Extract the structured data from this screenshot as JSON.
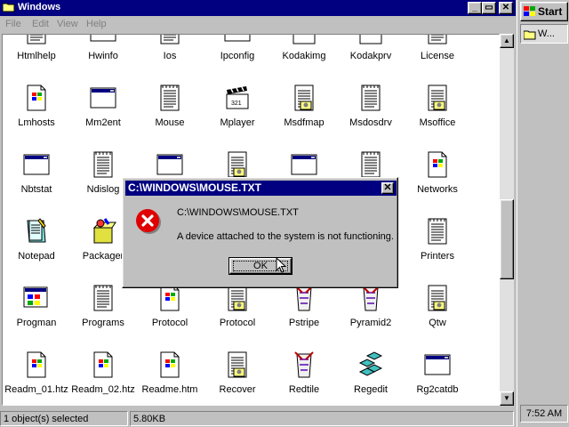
{
  "window": {
    "title": "Windows",
    "menu": [
      "File",
      "Edit",
      "View",
      "Help"
    ]
  },
  "files": [
    {
      "label": "Htmlhelp",
      "icon": "notepad-doc-icon"
    },
    {
      "label": "Hwinfo",
      "icon": "window-icon"
    },
    {
      "label": "Ios",
      "icon": "notepad-doc-icon"
    },
    {
      "label": "Ipconfig",
      "icon": "window-icon"
    },
    {
      "label": "Kodakimg",
      "icon": "kodak-image-icon"
    },
    {
      "label": "Kodakprv",
      "icon": "kodak-image-icon"
    },
    {
      "label": "License",
      "icon": "notepad-doc-icon"
    },
    {
      "label": "Lmhosts",
      "icon": "windows-doc-icon"
    },
    {
      "label": "Mm2ent",
      "icon": "window-icon"
    },
    {
      "label": "Mouse",
      "icon": "notepad-doc-icon"
    },
    {
      "label": "Mplayer",
      "icon": "clapper-icon"
    },
    {
      "label": "Msdfmap",
      "icon": "settings-doc-icon"
    },
    {
      "label": "Msdosdrv",
      "icon": "notepad-doc-icon"
    },
    {
      "label": "Msoffice",
      "icon": "settings-doc-icon"
    },
    {
      "label": "Nbtstat",
      "icon": "window-icon"
    },
    {
      "label": "Ndislog",
      "icon": "notepad-doc-icon"
    },
    {
      "label": "",
      "icon": "window-icon"
    },
    {
      "label": "",
      "icon": "settings-doc-icon"
    },
    {
      "label": "",
      "icon": "window-icon"
    },
    {
      "label": "",
      "icon": "notepad-doc-icon"
    },
    {
      "label": "Networks",
      "icon": "windows-doc-icon"
    },
    {
      "label": "Notepad",
      "icon": "notepad-app-icon"
    },
    {
      "label": "Packager",
      "icon": "packager-icon"
    },
    {
      "label": "",
      "icon": ""
    },
    {
      "label": "",
      "icon": ""
    },
    {
      "label": "",
      "icon": ""
    },
    {
      "label": "",
      "icon": ""
    },
    {
      "label": "Printers",
      "icon": "notepad-doc-icon"
    },
    {
      "label": "Progman",
      "icon": "program-manager-icon"
    },
    {
      "label": "Programs",
      "icon": "notepad-doc-icon"
    },
    {
      "label": "Protocol",
      "icon": "windows-doc-icon"
    },
    {
      "label": "Protocol",
      "icon": "settings-doc-icon"
    },
    {
      "label": "Pstripe",
      "icon": "pstripe-icon"
    },
    {
      "label": "Pyramid2",
      "icon": "pstripe-icon"
    },
    {
      "label": "Qtw",
      "icon": "settings-doc-icon"
    },
    {
      "label": "Readm_01.htz",
      "icon": "windows-doc-icon"
    },
    {
      "label": "Readm_02.htz",
      "icon": "windows-doc-icon"
    },
    {
      "label": "Readme.htm",
      "icon": "windows-doc-icon"
    },
    {
      "label": "Recover",
      "icon": "settings-doc-icon"
    },
    {
      "label": "Redtile",
      "icon": "pstripe-icon"
    },
    {
      "label": "Regedit",
      "icon": "regedit-icon"
    },
    {
      "label": "Rg2catdb",
      "icon": "window-icon"
    }
  ],
  "status": {
    "selected": "1 object(s) selected",
    "size": "5.80KB"
  },
  "taskbar": {
    "start_label": "Start",
    "task_label": "W...",
    "clock": "7:52 AM"
  },
  "dialog": {
    "title": "C:\\WINDOWS\\MOUSE.TXT",
    "path": "C:\\WINDOWS\\MOUSE.TXT",
    "message": "A device attached to the system is not functioning.",
    "ok_label": "OK",
    "icon": "error-icon"
  },
  "colors": {
    "titlebar": "#000080",
    "face": "#c0c0c0",
    "error_red": "#e00000"
  }
}
